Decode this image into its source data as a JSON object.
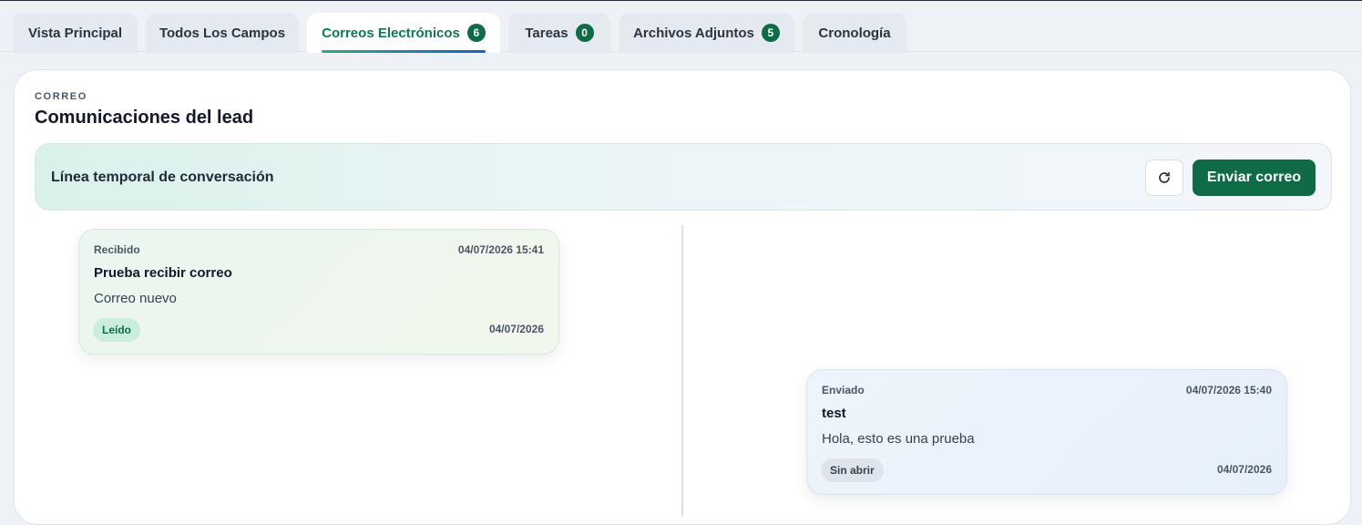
{
  "tabs": [
    {
      "label": "Vista Principal",
      "badge": null
    },
    {
      "label": "Todos Los Campos",
      "badge": null
    },
    {
      "label": "Correos Electrónicos",
      "badge": "6",
      "active": true
    },
    {
      "label": "Tareas",
      "badge": "0"
    },
    {
      "label": "Archivos Adjuntos",
      "badge": "5"
    },
    {
      "label": "Cronología",
      "badge": null
    }
  ],
  "section": {
    "eyebrow": "CORREO",
    "title": "Comunicaciones del lead"
  },
  "timeline": {
    "label": "Línea temporal de conversación",
    "refresh_icon": "refresh-icon",
    "send_label": "Enviar correo"
  },
  "messages": [
    {
      "direction": "Recibido",
      "timestamp": "04/07/2026 15:41",
      "subject": "Prueba recibir correo",
      "body": "Correo nuevo",
      "status": "Leído",
      "date": "04/07/2026"
    },
    {
      "direction": "Enviado",
      "timestamp": "04/07/2026 15:40",
      "subject": "test",
      "body": "Hola, esto es una prueba",
      "status": "Sin abrir",
      "date": "04/07/2026"
    }
  ],
  "colors": {
    "accent": "#0f6b45",
    "active_tab_text": "#0f7a4f"
  }
}
